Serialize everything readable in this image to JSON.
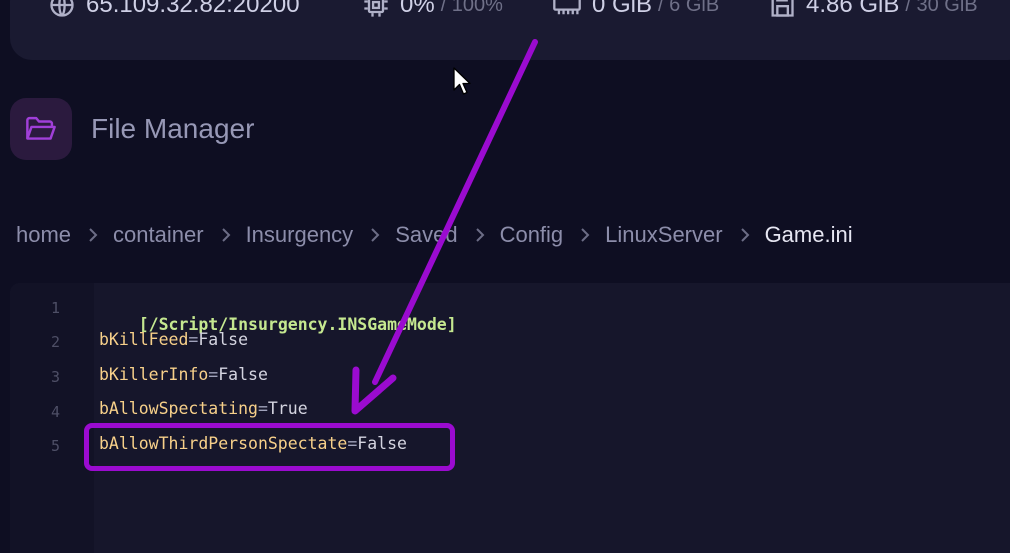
{
  "stats": [
    {
      "icon": "globe-icon",
      "value": "65.109.32.82:20200",
      "limit": ""
    },
    {
      "icon": "cpu-icon",
      "value": "0%",
      "limit": "/ 100%"
    },
    {
      "icon": "memory-icon",
      "value": "0 GiB",
      "limit": "/ 6 GiB"
    },
    {
      "icon": "disk-icon",
      "value": "4.86 GiB",
      "limit": "/ 30 GiB"
    }
  ],
  "page": {
    "title": "File Manager",
    "icon": "folder-open-icon"
  },
  "breadcrumb": [
    "home",
    "container",
    "Insurgency",
    "Saved",
    "Config",
    "LinuxServer",
    "Game.ini"
  ],
  "editor": {
    "lines": [
      {
        "number": "1",
        "section": "[/Script/Insurgency.INSGameMode]"
      },
      {
        "number": "2",
        "key": "bKillFeed",
        "eq": "=",
        "value": "False"
      },
      {
        "number": "3",
        "key": "bKillerInfo",
        "eq": "=",
        "value": "False"
      },
      {
        "number": "4",
        "key": "bAllowSpectating",
        "eq": "=",
        "value": "True"
      },
      {
        "number": "5",
        "key": "bAllowThirdPersonSpectate",
        "eq": "=",
        "value": "False"
      }
    ]
  },
  "annotation": {
    "color": "#9b0bd0",
    "icon": "arrow-annotation-icon"
  },
  "colors": {
    "background": "#0e0e22",
    "panel": "#1a1a31",
    "accent": "#9b0bd0",
    "section": "#c5e890",
    "key": "#f7d08a"
  }
}
